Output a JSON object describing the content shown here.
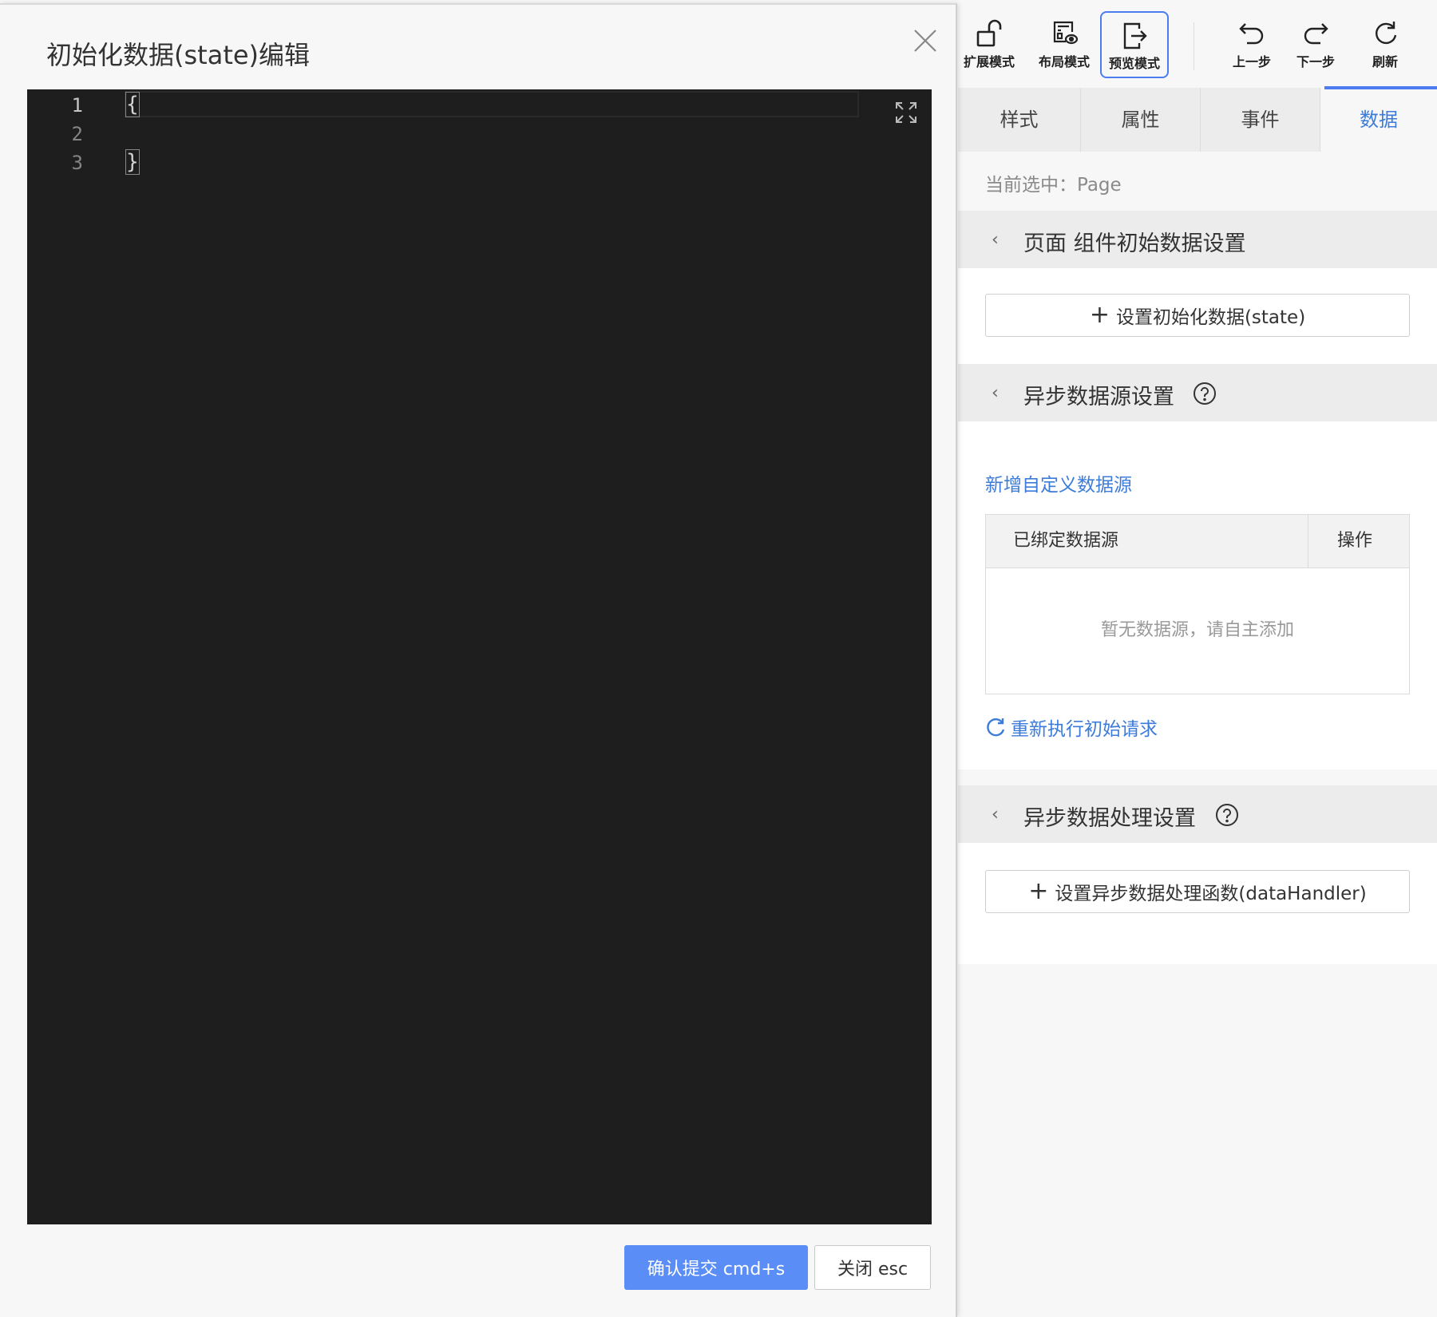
{
  "modal": {
    "title": "初始化数据(state)编辑",
    "editor": {
      "line_numbers": [
        "1",
        "2",
        "3"
      ],
      "lines": [
        "{",
        "",
        "}"
      ]
    },
    "confirm_label": "确认提交 cmd+s",
    "close_label": "关闭 esc"
  },
  "toolbar": {
    "items": [
      {
        "label": "扩展模式",
        "icon": "unlock-icon"
      },
      {
        "label": "布局模式",
        "icon": "layout-view-icon"
      },
      {
        "label": "预览模式",
        "icon": "exit-preview-icon",
        "active": true
      },
      {
        "label": "上一步",
        "icon": "undo-icon"
      },
      {
        "label": "下一步",
        "icon": "redo-icon"
      },
      {
        "label": "刷新",
        "icon": "refresh-icon"
      }
    ],
    "active_color": "#4b7cf0"
  },
  "tabs": [
    {
      "label": "样式"
    },
    {
      "label": "属性"
    },
    {
      "label": "事件"
    },
    {
      "label": "数据",
      "active": true
    }
  ],
  "selected": {
    "prefix": "当前选中：",
    "value": "Page"
  },
  "sections": {
    "page_state": {
      "title": "页面 组件初始数据设置",
      "button_label": "设置初始化数据(state)"
    },
    "async_source": {
      "title": "异步数据源设置",
      "add_link": "新增自定义数据源",
      "table": {
        "col_source": "已绑定数据源",
        "col_action": "操作",
        "empty_text": "暂无数据源，请自主添加"
      },
      "rerun_link": "重新执行初始请求"
    },
    "async_handler": {
      "title": "异步数据处理设置",
      "button_label": "设置异步数据处理函数(dataHandler)"
    }
  },
  "colors": {
    "primary": "#5a8df5",
    "link": "#3d7bd9",
    "editor_bg": "#1e1e1e"
  }
}
